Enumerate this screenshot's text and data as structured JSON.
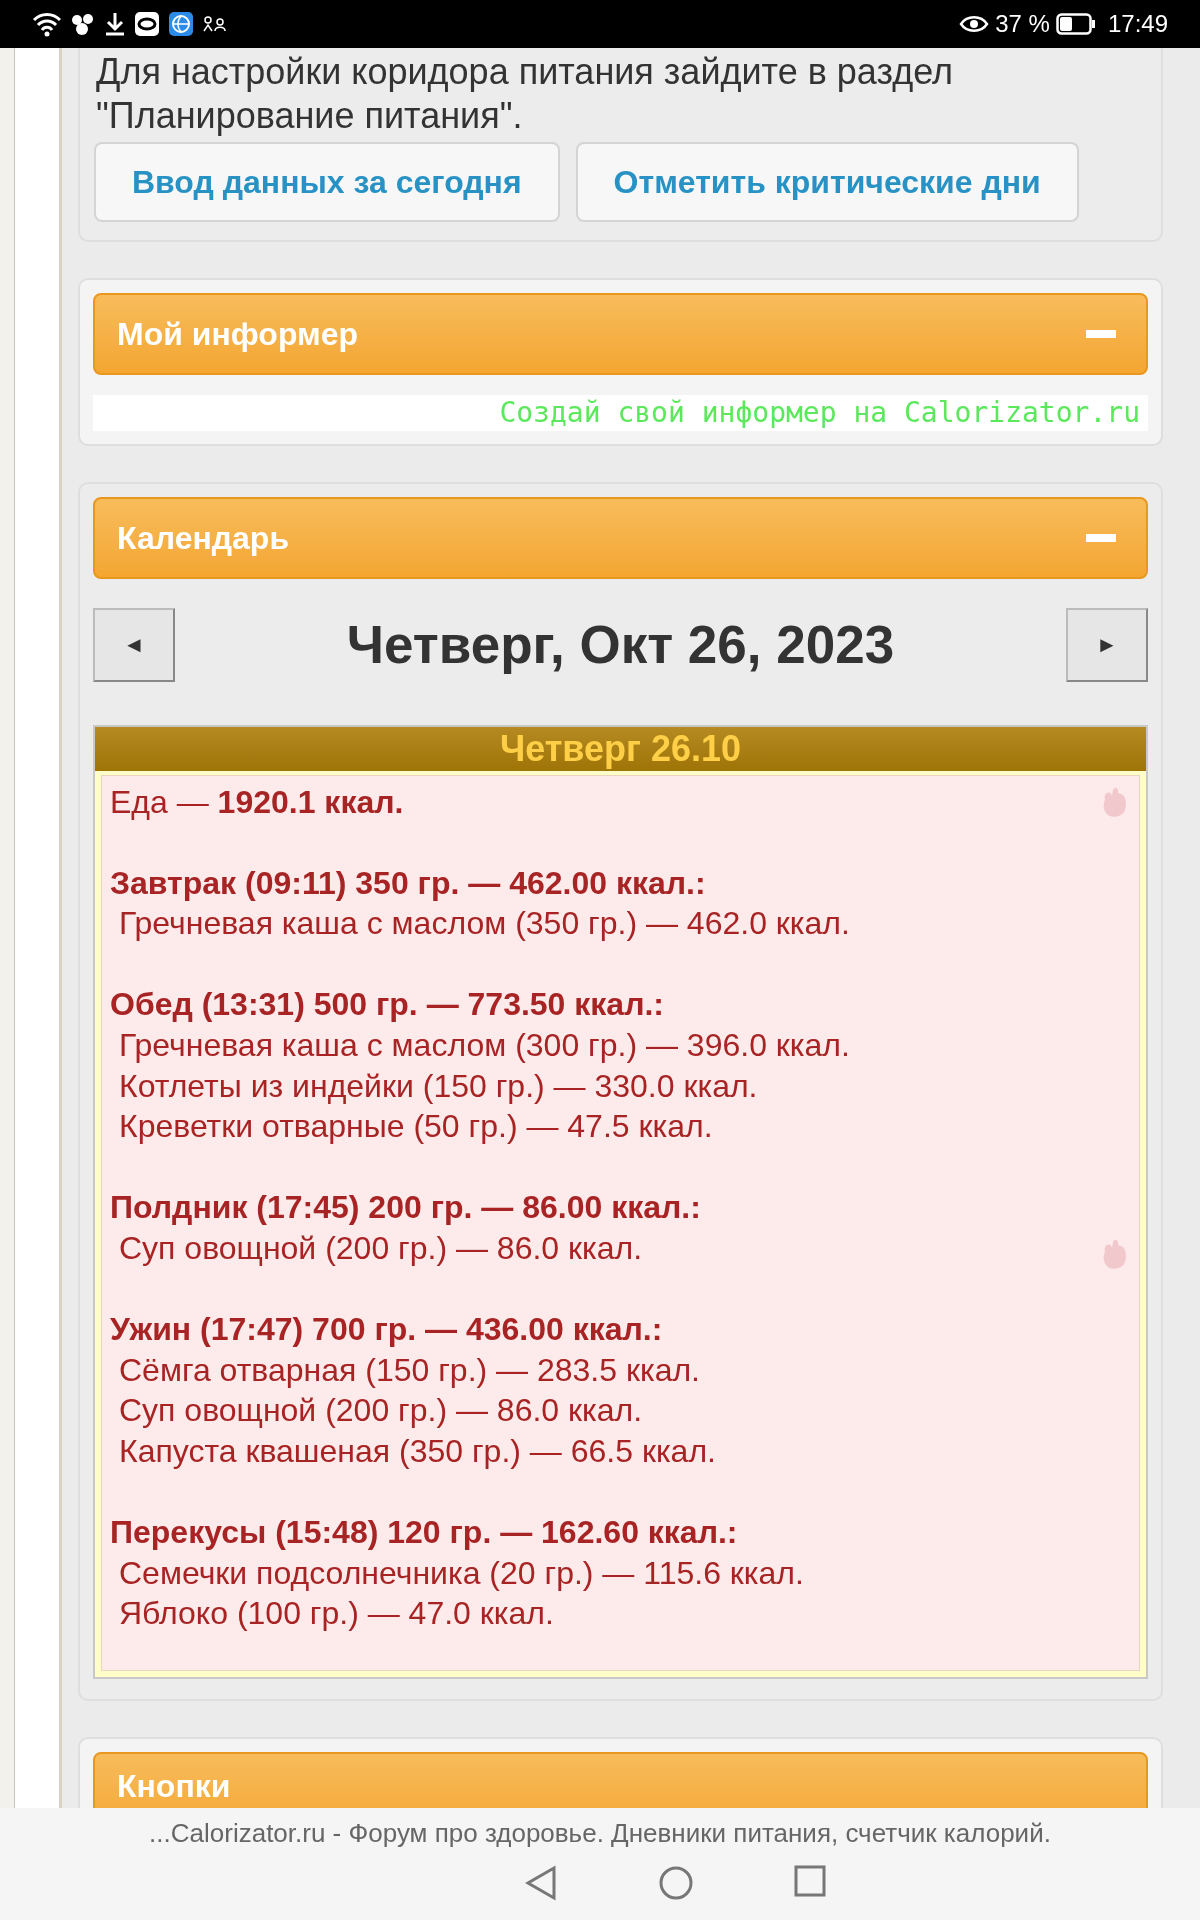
{
  "status_bar": {
    "battery": "37 %",
    "time": "17:49"
  },
  "intro": {
    "text": "Для настройки коридора питания зайдите в раздел \"Планирование питания\".",
    "buttons": [
      "Ввод данных за сегодня",
      "Отметить критические дни"
    ]
  },
  "informer": {
    "title": "Мой информер",
    "expanded": true,
    "link": "Создай свой информер на Calorizator.ru"
  },
  "calendar": {
    "title": "Календарь",
    "expanded": true,
    "prev": "◄",
    "next": "►",
    "date": "Четверг, Окт 26, 2023",
    "day": {
      "heading": "Четверг 26.10",
      "total": "Еда — **1920.1 ккал.**",
      "meals": [
        {
          "title": "Завтрак (09:11) 350 гр. — 462.00 ккал.:",
          "items": [
            "Гречневая каша с маслом (350 гр.) — 462.0 ккал."
          ]
        },
        {
          "title": "Обед (13:31) 500 гр. — 773.50 ккал.:",
          "items": [
            "Гречневая каша с маслом (300 гр.) — 396.0 ккал.",
            "Котлеты из индейки (150 гр.) — 330.0 ккал.",
            "Креветки отварные (50 гр.) — 47.5 ккал."
          ]
        },
        {
          "title": "Полдник (17:45) 200 гр. — 86.00 ккал.:",
          "items": [
            "Суп овощной (200 гр.) — 86.0 ккал."
          ]
        },
        {
          "title": "Ужин (17:47) 700 гр. — 436.00 ккал.:",
          "items": [
            "Сёмга отварная (150 гр.) — 283.5 ккал.",
            "Суп овощной (200 гр.) — 86.0 ккал.",
            "Капуста квашеная (350 гр.) — 66.5 ккал."
          ]
        },
        {
          "title": "Перекусы (15:48) 120 гр. — 162.60 ккал.:",
          "items": [
            "Семечки подсолнечника (20 гр.) — 115.6 ккал.",
            "Яблоко (100 гр.) — 47.0 ккал."
          ]
        }
      ]
    }
  },
  "buttons_panel": {
    "title": "Кнопки"
  },
  "browser_bar": {
    "page_title": "...Calorizator.ru - Форум про здоровье. Дневники питания, счетчик калорий."
  }
}
